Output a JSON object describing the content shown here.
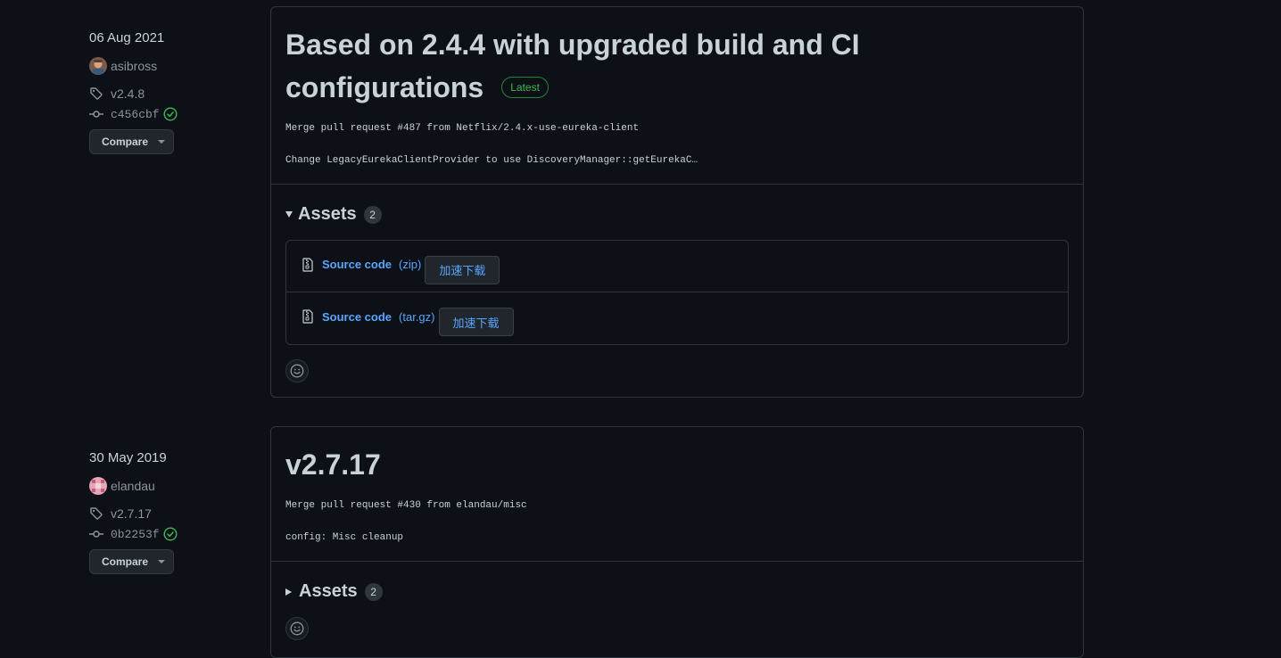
{
  "releases": [
    {
      "date": "06 Aug 2021",
      "author": "asibross",
      "tag": "v2.4.8",
      "commit": "c456cbf",
      "compare_label": "Compare",
      "title_line1": "Based on 2.4.4 with upgraded build and CI",
      "title_line2": "configurations",
      "latest_label": "Latest",
      "body_lines": [
        "Merge pull request #487 from Netflix/2.4.x-use-eureka-client",
        "Change LegacyEurekaClientProvider to use DiscoveryManager::getEurekaC…"
      ],
      "assets_label": "Assets",
      "assets_count": "2",
      "assets_expanded": true,
      "assets": [
        {
          "name": "Source code",
          "ext": "(zip)",
          "button": "加速下载"
        },
        {
          "name": "Source code",
          "ext": "(tar.gz)",
          "button": "加速下载"
        }
      ]
    },
    {
      "date": "30 May 2019",
      "author": "elandau",
      "tag": "v2.7.17",
      "commit": "0b2253f",
      "compare_label": "Compare",
      "title_line1": "v2.7.17",
      "body_lines": [
        "Merge pull request #430 from elandau/misc",
        "config: Misc cleanup"
      ],
      "assets_label": "Assets",
      "assets_count": "2",
      "assets_expanded": false
    }
  ],
  "icons": {
    "tag": "tag-icon",
    "commit": "git-commit-icon",
    "verified": "check-circle-icon",
    "zip": "file-zip-icon",
    "emoji": "smiley-icon"
  },
  "colors": {
    "background": "#0d1117",
    "border": "#30363d",
    "text": "#c9d1d9",
    "muted": "#8b949e",
    "link": "#58a6ff",
    "success": "#3fb950"
  }
}
